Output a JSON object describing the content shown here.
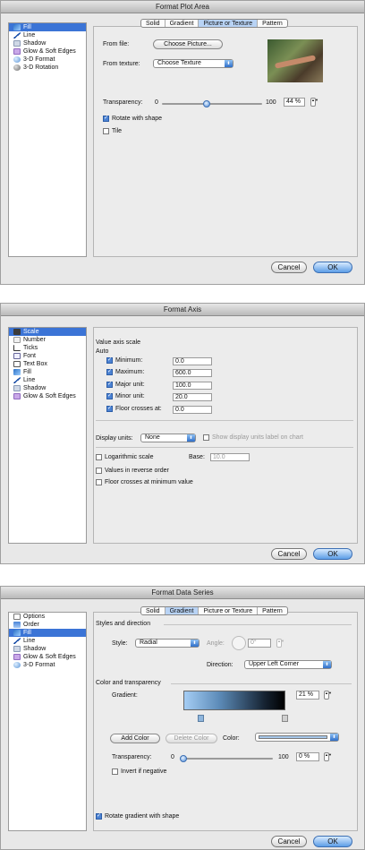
{
  "plot_area": {
    "title": "Format Plot Area",
    "sidebar": [
      {
        "label": "Fill",
        "icon": "fill-icon",
        "selected": true
      },
      {
        "label": "Line",
        "icon": "line-icon"
      },
      {
        "label": "Shadow",
        "icon": "shadow-icon"
      },
      {
        "label": "Glow & Soft Edges",
        "icon": "glow-icon"
      },
      {
        "label": "3-D Format",
        "icon": "3d-format-icon"
      },
      {
        "label": "3-D Rotation",
        "icon": "3d-rotation-icon"
      }
    ],
    "tabs": [
      "Solid",
      "Gradient",
      "Picture or Texture",
      "Pattern"
    ],
    "active_tab": "Picture or Texture",
    "from_file_label": "From file:",
    "choose_picture": "Choose Picture...",
    "from_texture_label": "From texture:",
    "choose_texture": "Choose Texture",
    "transparency_label": "Transparency:",
    "slider_min": "0",
    "slider_max": "100",
    "transparency_value": "44 %",
    "transparency_level": 44,
    "rotate_label": "Rotate with shape",
    "rotate_checked": true,
    "tile_label": "Tile",
    "tile_checked": false,
    "cancel": "Cancel",
    "ok": "OK"
  },
  "axis": {
    "title": "Format Axis",
    "sidebar": [
      {
        "label": "Scale",
        "icon": "scale-icon",
        "selected": true
      },
      {
        "label": "Number",
        "icon": "number-icon"
      },
      {
        "label": "Ticks",
        "icon": "ticks-icon"
      },
      {
        "label": "Font",
        "icon": "font-icon"
      },
      {
        "label": "Text Box",
        "icon": "text-box-icon"
      },
      {
        "label": "Fill",
        "icon": "fill-icon"
      },
      {
        "label": "Line",
        "icon": "line-icon"
      },
      {
        "label": "Shadow",
        "icon": "shadow-icon"
      },
      {
        "label": "Glow & Soft Edges",
        "icon": "glow-icon"
      }
    ],
    "section_title": "Value axis scale",
    "auto_label": "Auto",
    "fields": [
      {
        "label": "Minimum:",
        "value": "0.0",
        "checked": true
      },
      {
        "label": "Maximum:",
        "value": "600.0",
        "checked": true
      },
      {
        "label": "Major unit:",
        "value": "100.0",
        "checked": true
      },
      {
        "label": "Minor unit:",
        "value": "20.0",
        "checked": true
      },
      {
        "label": "Floor crosses at:",
        "value": "0.0",
        "checked": true
      }
    ],
    "display_units_label": "Display units:",
    "display_units_value": "None",
    "show_units_label": "Show display units label on chart",
    "log_label": "Logarithmic scale",
    "base_label": "Base:",
    "base_value": "10.0",
    "reverse_label": "Values in reverse order",
    "floor_min_label": "Floor crosses at minimum value",
    "cancel": "Cancel",
    "ok": "OK"
  },
  "series": {
    "title": "Format Data Series",
    "sidebar": [
      {
        "label": "Options",
        "icon": "options-icon"
      },
      {
        "label": "Order",
        "icon": "order-icon"
      },
      {
        "label": "Fill",
        "icon": "fill-icon",
        "selected": true
      },
      {
        "label": "Line",
        "icon": "line-icon"
      },
      {
        "label": "Shadow",
        "icon": "shadow-icon"
      },
      {
        "label": "Glow & Soft Edges",
        "icon": "glow-icon"
      },
      {
        "label": "3-D Format",
        "icon": "3d-format-icon"
      }
    ],
    "tabs": [
      "Solid",
      "Gradient",
      "Picture or Texture",
      "Pattern"
    ],
    "active_tab": "Gradient",
    "styles_section": "Styles and direction",
    "style_label": "Style:",
    "style_value": "Radial",
    "angle_label": "Angle:",
    "angle_value": "0°",
    "direction_label": "Direction:",
    "direction_value": "Upper Left Corner",
    "color_section": "Color and transparency",
    "gradient_label": "Gradient:",
    "gradient_value": "21 %",
    "add_color": "Add Color",
    "delete_color": "Delete Color",
    "color_label": "Color:",
    "transparency_label": "Transparency:",
    "slider_min": "0",
    "slider_max": "100",
    "transparency_value": "0 %",
    "transparency_level": 0,
    "invert_label": "Invert if negative",
    "rotate_label": "Rotate gradient with shape",
    "rotate_checked": true,
    "cancel": "Cancel",
    "ok": "OK"
  }
}
